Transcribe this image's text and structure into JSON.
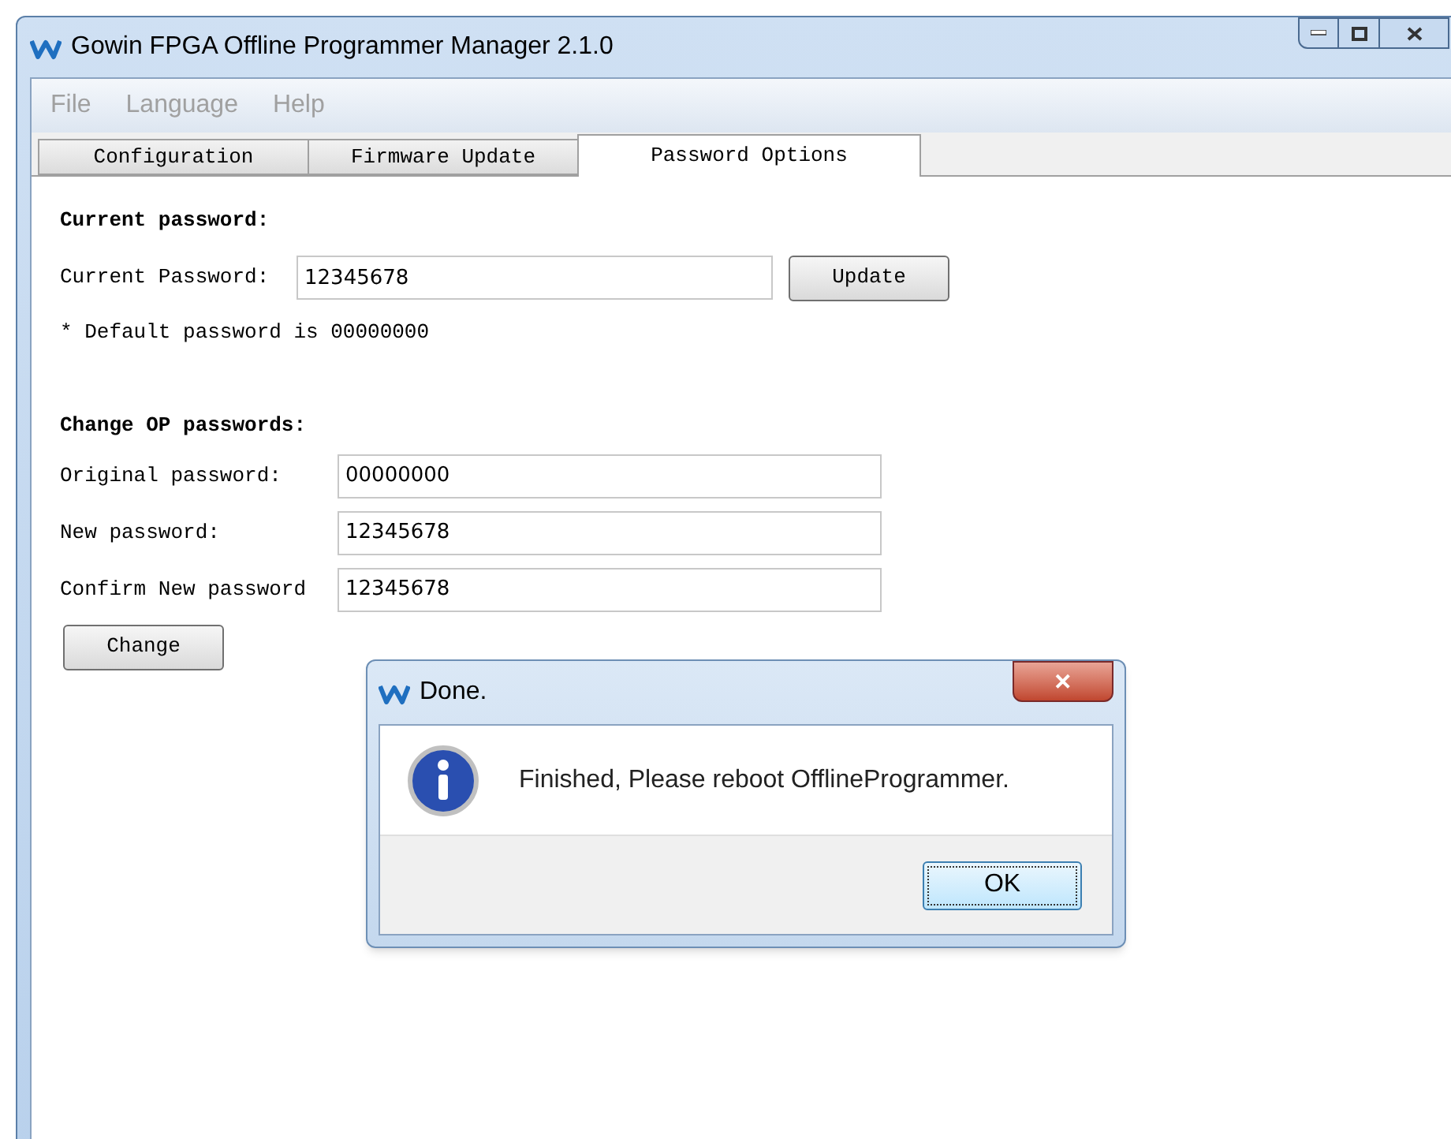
{
  "window": {
    "title": "Gowin FPGA Offline Programmer Manager 2.1.0"
  },
  "menu": [
    {
      "label": "File",
      "disabled": true
    },
    {
      "label": "Language",
      "disabled": true
    },
    {
      "label": "Help",
      "disabled": true
    }
  ],
  "tabs": [
    {
      "label": "Configuration",
      "selected": false
    },
    {
      "label": "Firmware Update",
      "selected": false
    },
    {
      "label": "Password Options",
      "selected": true
    }
  ],
  "current_section": {
    "heading": "Current password:",
    "label": "Current Password:",
    "value": "12345678",
    "button": "Update",
    "note": "* Default password is 00000000"
  },
  "change_section": {
    "heading": "Change OP passwords:",
    "fields": [
      {
        "label": "Original password:",
        "value": "00000000"
      },
      {
        "label": "New password:",
        "value": "12345678"
      },
      {
        "label": "Confirm New password",
        "value": "12345678"
      }
    ],
    "button": "Change"
  },
  "dialog": {
    "title": "Done.",
    "close": "✕",
    "message": "Finished, Please reboot OfflineProgrammer.",
    "button": "OK"
  }
}
